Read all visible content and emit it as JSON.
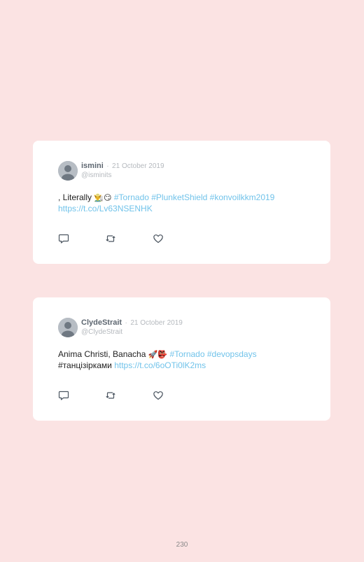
{
  "tweets": [
    {
      "name": "ismini",
      "separator": "·",
      "date": "21 October 2019",
      "handle": "@isminits",
      "text_prefix": ", Literally ",
      "emoji": "👨‍🌾😏",
      "hashtags": "#Tornado #PlunketShield #konvoilkkm2019",
      "line2_plain": "",
      "url": "https://t.co/Lv63NSENHK",
      "icons": [
        "reply-icon",
        "retweet-icon",
        "like-icon"
      ]
    },
    {
      "name": "ClydeStrait",
      "separator": "·",
      "date": "21 October 2019",
      "handle": "@ClydeStrait",
      "text_prefix": "Anima Christi, Banacha ",
      "emoji": "🚀👺",
      "hashtags": "#Tornado #devopsdays",
      "line2_plain": "#танцізірками ",
      "url": "https://t.co/6oOTi0lK2ms",
      "icons": [
        "reply-icon",
        "retweet-icon",
        "like-icon"
      ]
    }
  ],
  "page_number": "230",
  "colors": {
    "background": "#fbe3e3",
    "card": "#ffffff",
    "link": "#71c3ea",
    "muted": "#b5b9be",
    "name": "#5d6670"
  }
}
